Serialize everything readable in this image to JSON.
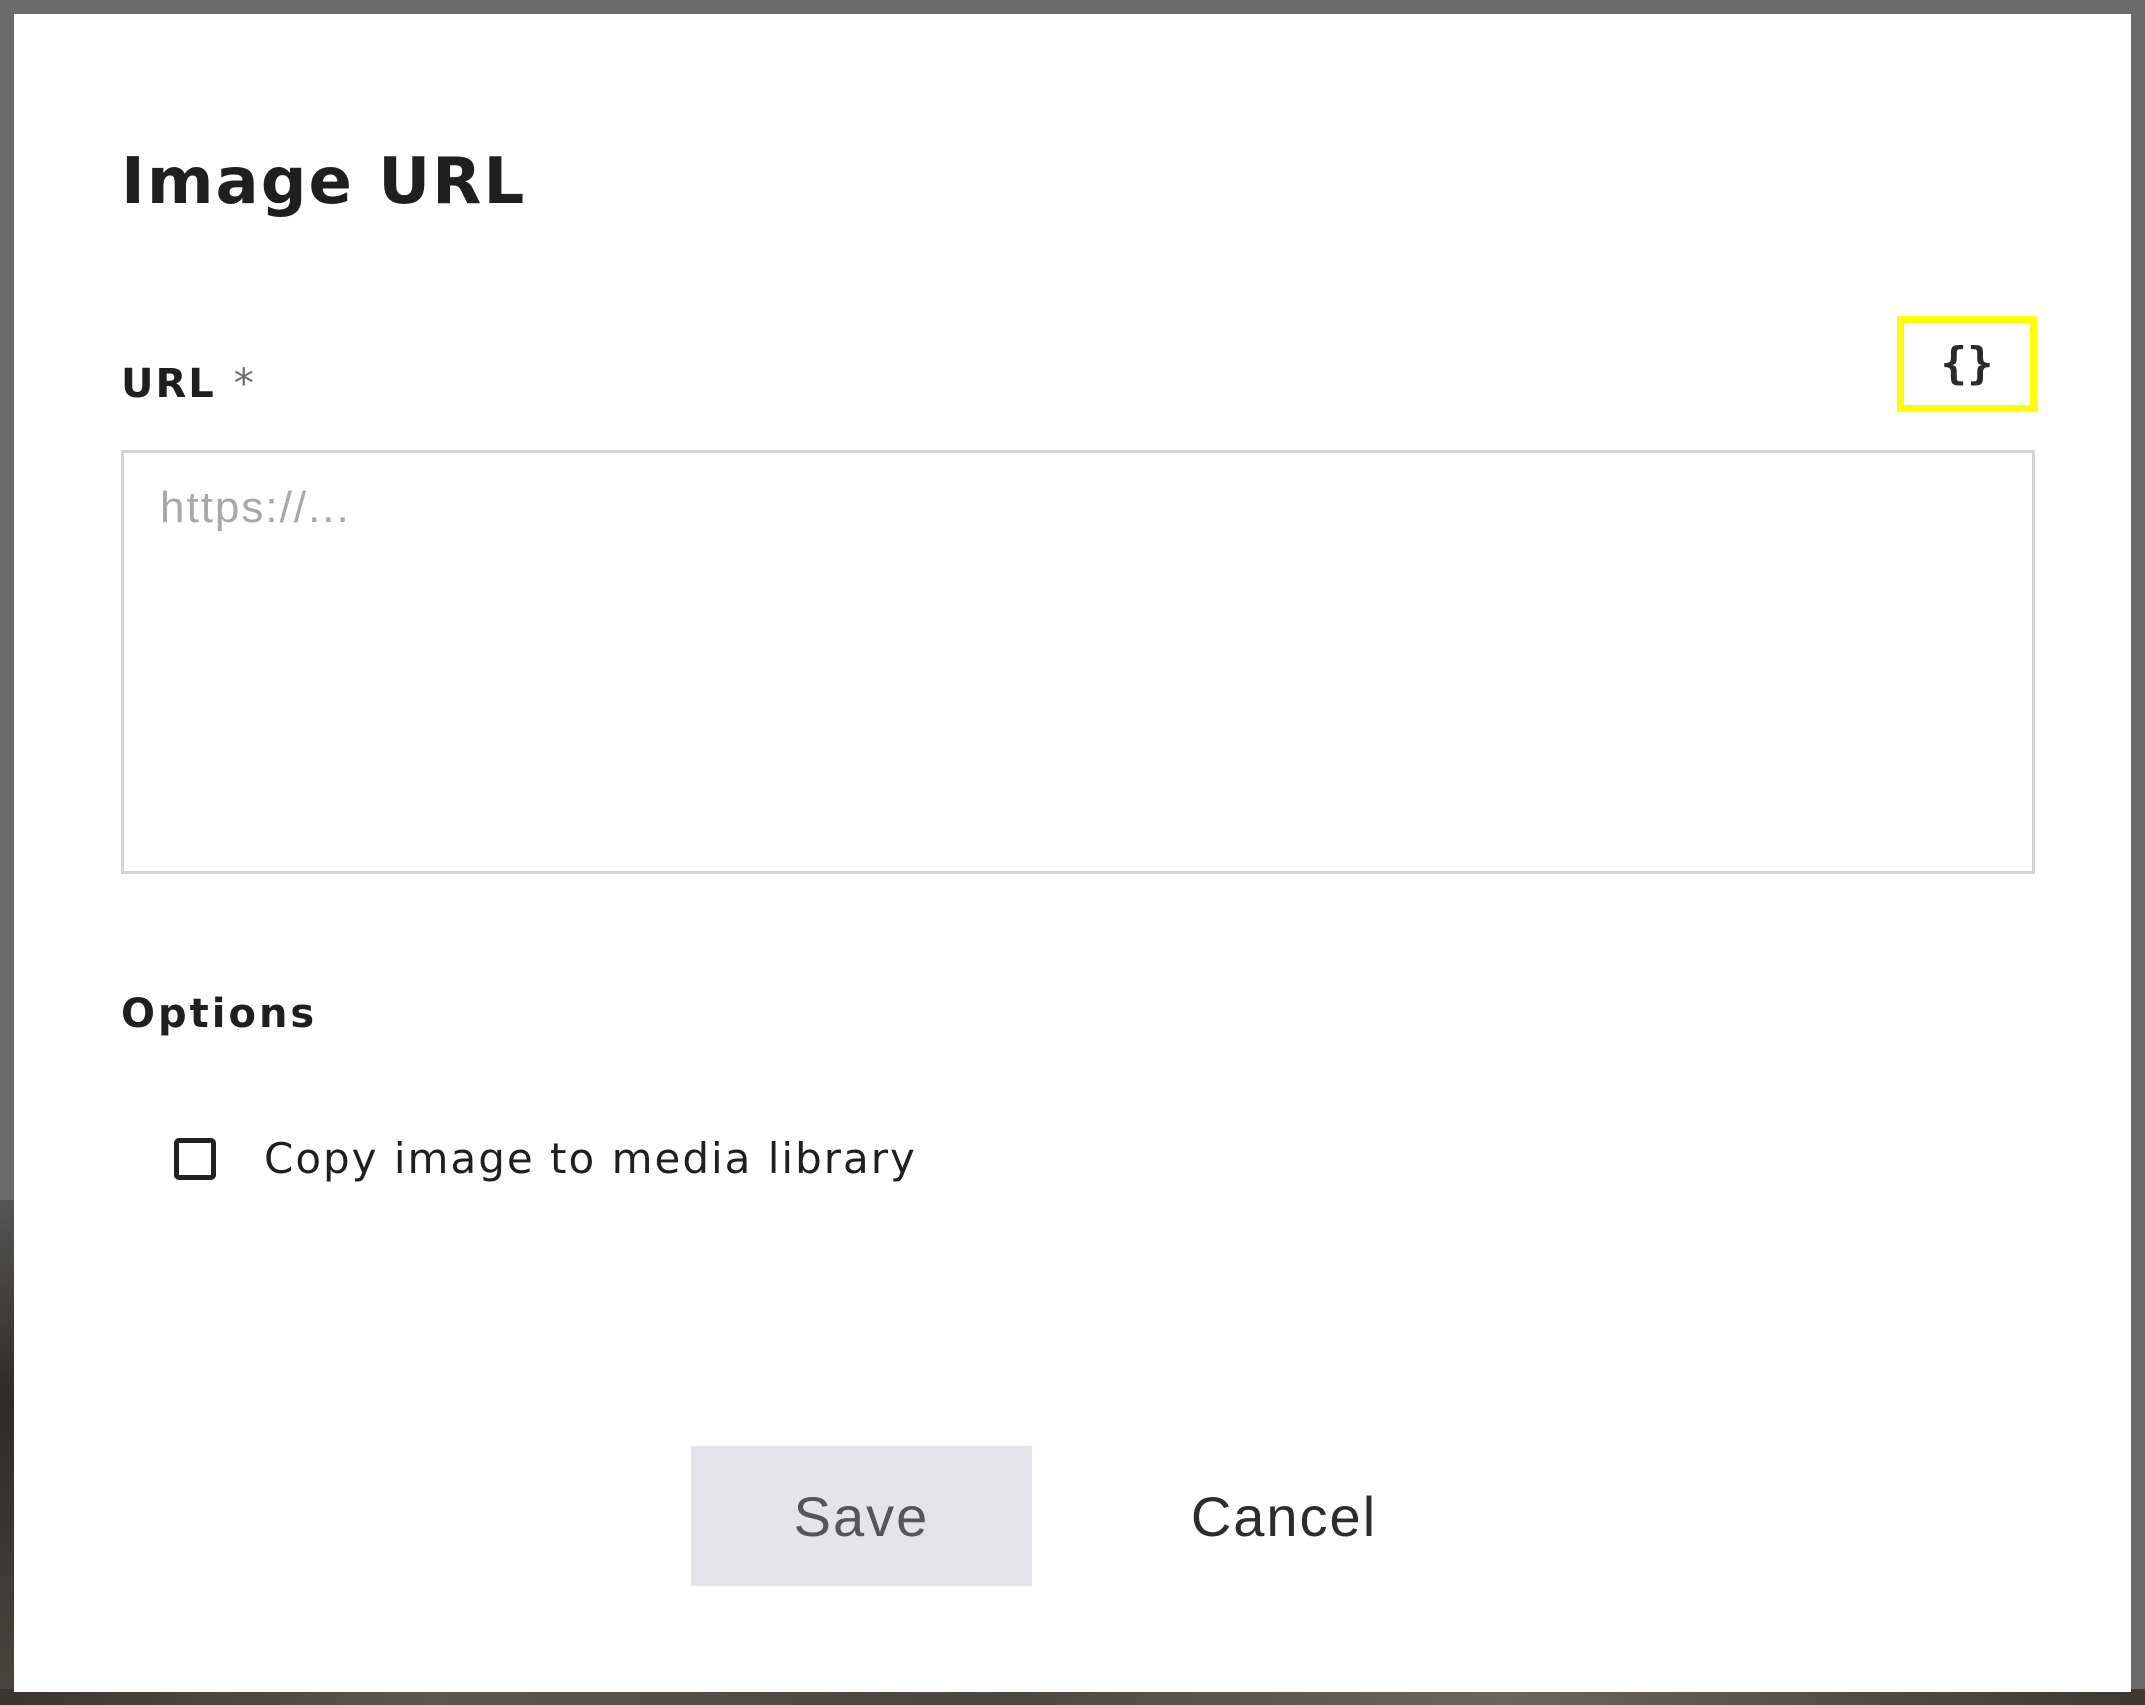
{
  "dialog": {
    "title": "Image URL",
    "url_field": {
      "label": "URL",
      "required_mark": "*",
      "placeholder": "https://...",
      "value": "",
      "variable_button_icon": "braces-icon",
      "variable_button_glyph": "{}"
    },
    "options": {
      "heading": "Options",
      "copy_to_library": {
        "label": "Copy image to media library",
        "checked": false
      }
    },
    "actions": {
      "save_label": "Save",
      "cancel_label": "Cancel"
    }
  },
  "colors": {
    "highlight": "#ffff00",
    "save_background": "#e4e4ea",
    "overlay": "#6b6b6b"
  }
}
